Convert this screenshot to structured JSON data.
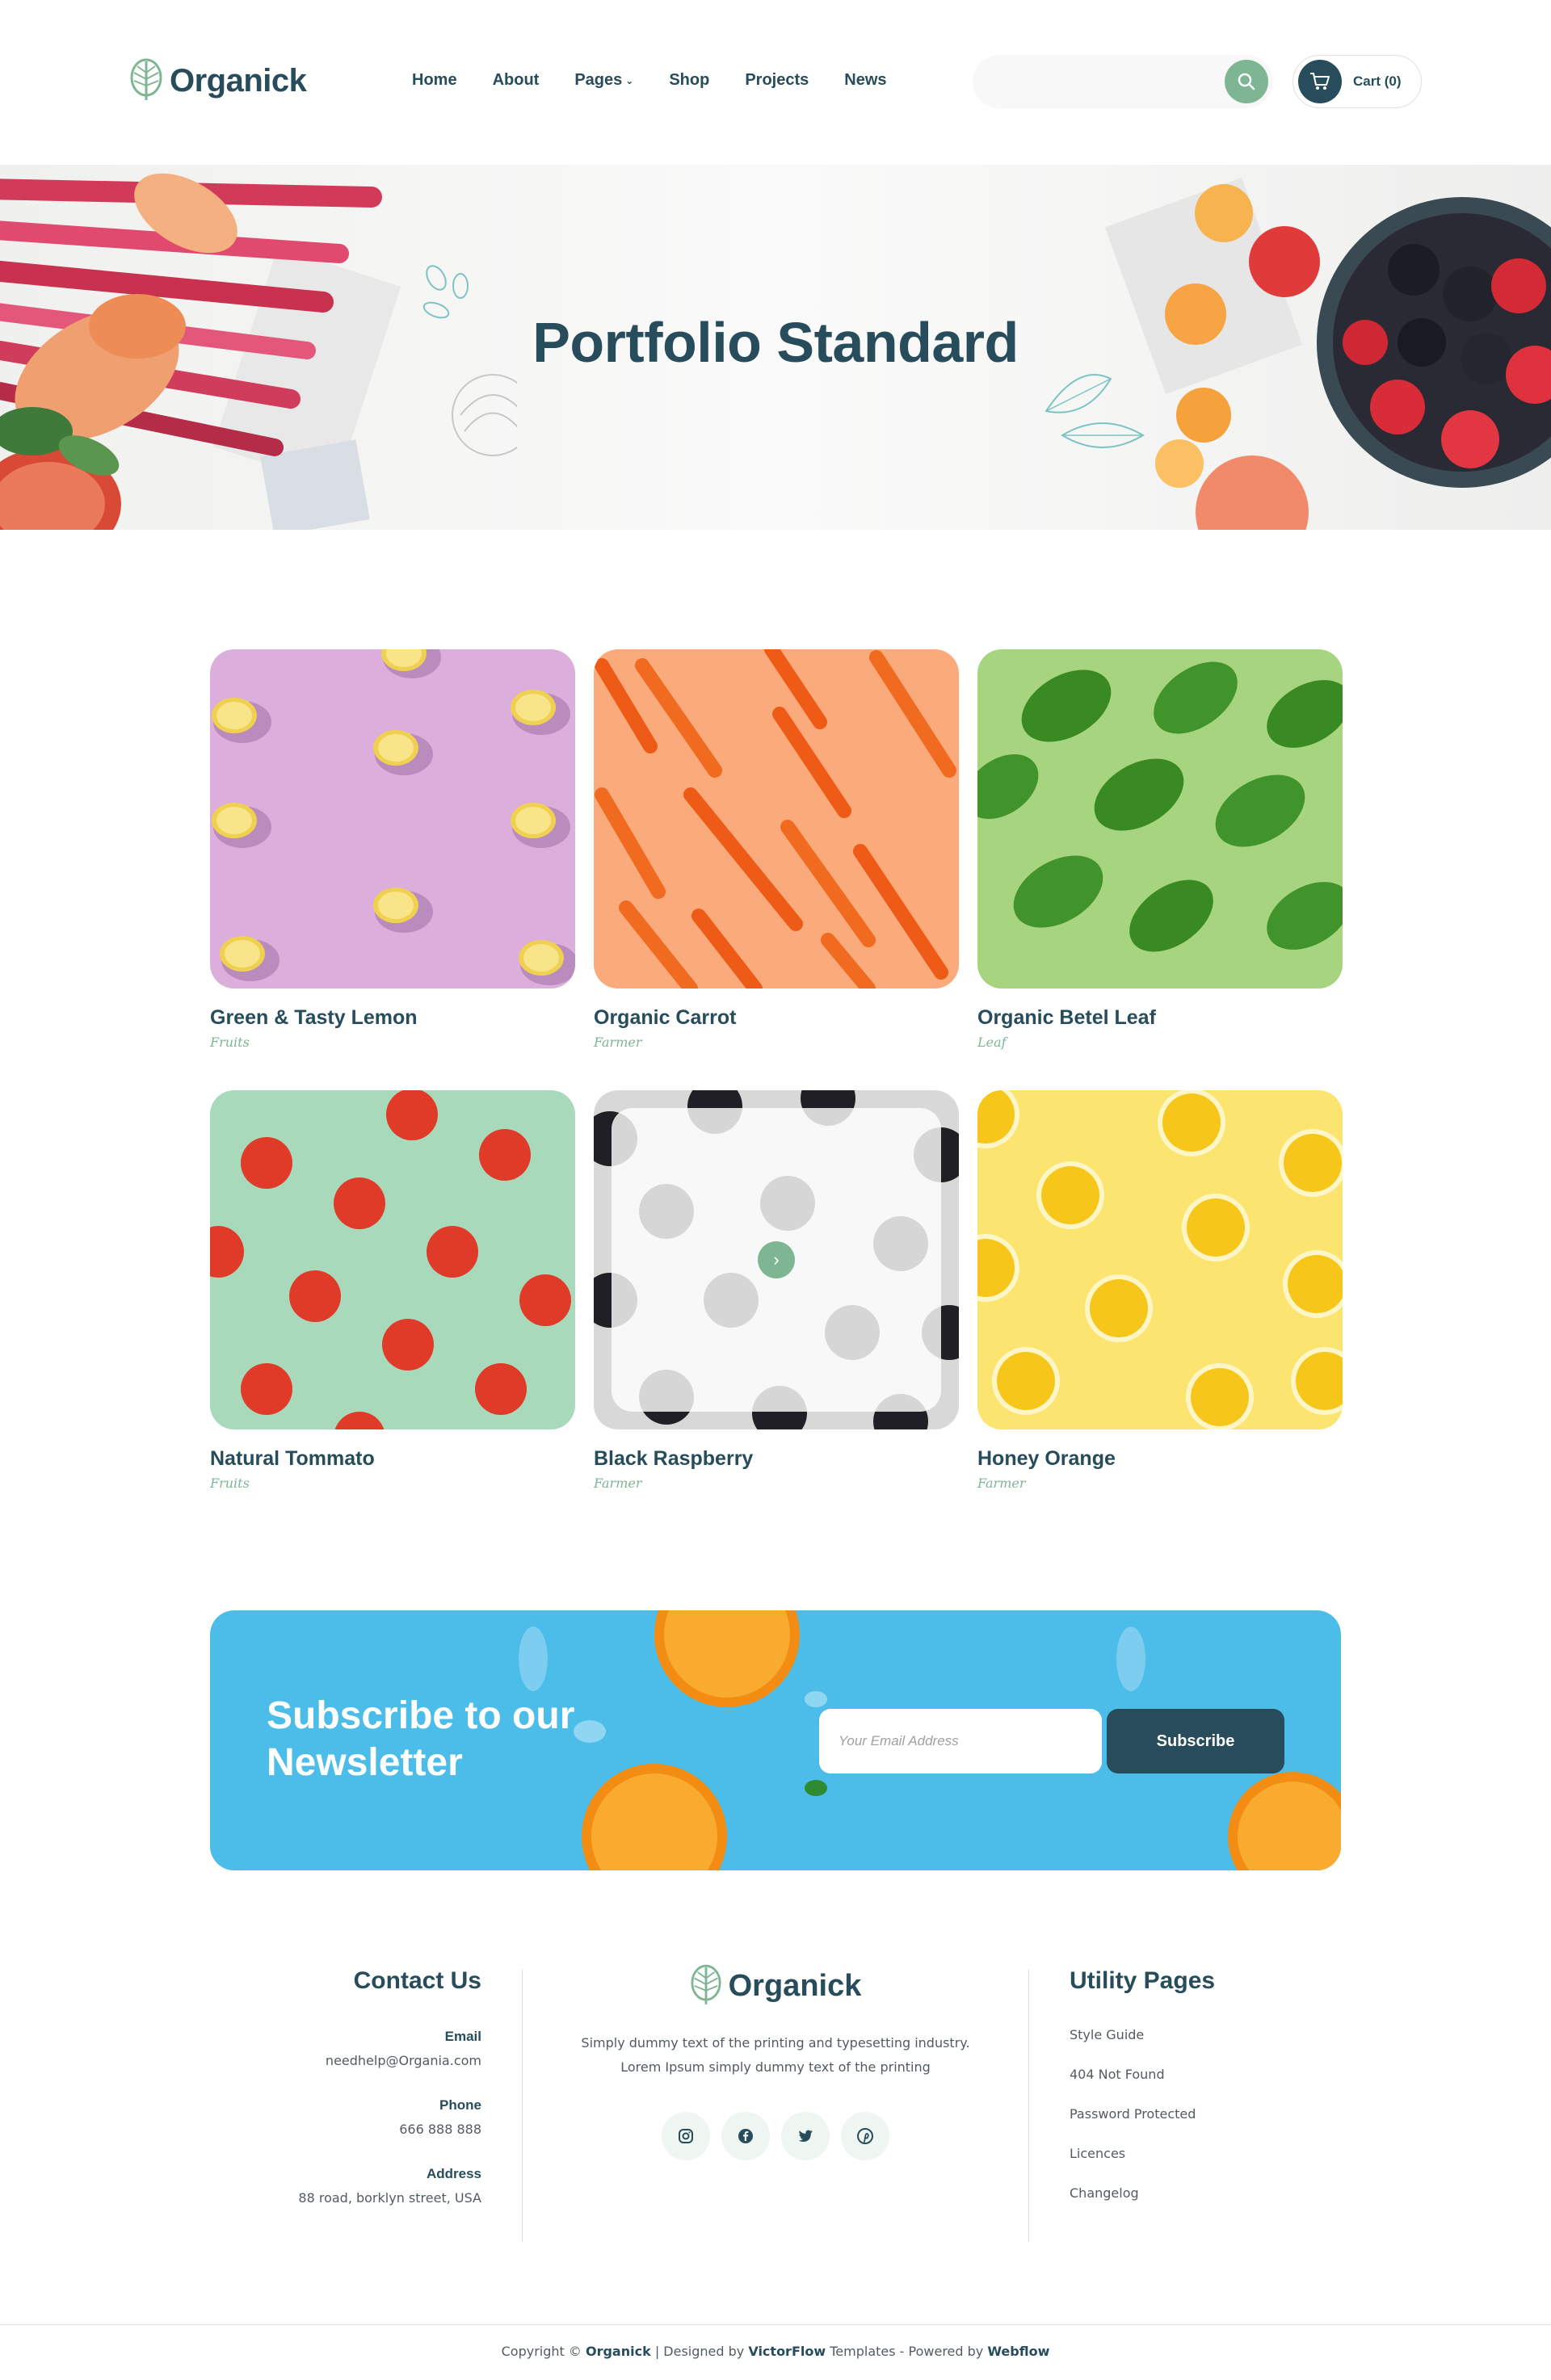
{
  "brand": {
    "name": "Organick"
  },
  "nav": {
    "items": [
      {
        "label": "Home"
      },
      {
        "label": "About"
      },
      {
        "label": "Pages",
        "dropdown": true
      },
      {
        "label": "Shop"
      },
      {
        "label": "Projects"
      },
      {
        "label": "News"
      }
    ]
  },
  "header": {
    "search_placeholder": "",
    "cart_label": "Cart (0)"
  },
  "hero": {
    "title": "Portfolio Standard"
  },
  "portfolio": {
    "items": [
      {
        "title": "Green & Tasty Lemon",
        "tag": "Fruits",
        "bg": "#dcaedc",
        "motif": "lemon-halves"
      },
      {
        "title": "Organic Carrot",
        "tag": "Farmer",
        "bg": "#fbaa7b",
        "motif": "carrots"
      },
      {
        "title": "Organic Betel Leaf",
        "tag": "Leaf",
        "bg": "#a7d57f",
        "motif": "basil-leaves"
      },
      {
        "title": "Natural Tommato",
        "tag": "Fruits",
        "bg": "#a8d9ba",
        "motif": "tomatoes"
      },
      {
        "title": "Black Raspberry",
        "tag": "Farmer",
        "bg": "#d8d8d8",
        "motif": "blackberries",
        "hover": true
      },
      {
        "title": "Honey Orange",
        "tag": "Farmer",
        "bg": "#fbe46f",
        "motif": "lemon-slices"
      }
    ]
  },
  "newsletter": {
    "title": "Subscribe to our Newsletter",
    "email_placeholder": "Your Email Address",
    "button_label": "Subscribe"
  },
  "footer": {
    "contact": {
      "heading": "Contact Us",
      "email_label": "Email",
      "email_value": "needhelp@Organia.com",
      "phone_label": "Phone",
      "phone_value": "666 888 888",
      "address_label": "Address",
      "address_value": "88 road, borklyn street, USA"
    },
    "description_line1": "Simply dummy text of the printing and typesetting industry.",
    "description_line2": "Lorem Ipsum simply dummy text of the printing",
    "socials": [
      "instagram-icon",
      "facebook-icon",
      "twitter-icon",
      "pinterest-icon"
    ],
    "utility": {
      "heading": "Utility Pages",
      "links": [
        "Style Guide",
        "404 Not Found",
        "Password Protected",
        "Licences",
        "Changelog"
      ]
    },
    "copyright": {
      "prefix": "Copyright © ",
      "brand": "Organick",
      "mid": " | Designed by ",
      "designer": "VictorFlow",
      "mid2": " Templates - Powered by ",
      "platform": "Webflow"
    }
  },
  "colors": {
    "primary": "#274c5b",
    "accent": "#7eb693",
    "newsletter_bg": "#4bbde8"
  }
}
